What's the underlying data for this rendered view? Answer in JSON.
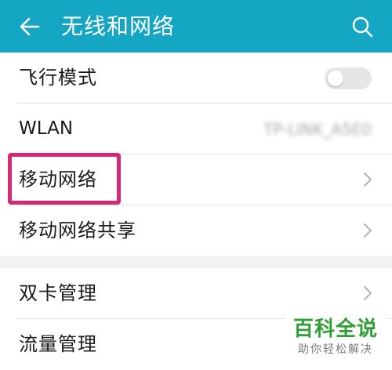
{
  "app_bar": {
    "title": "无线和网络",
    "back_icon": "arrow-left-icon",
    "search_icon": "search-icon",
    "background_color": "#14a6c2"
  },
  "settings": [
    {
      "group": 1,
      "items": [
        {
          "label": "飞行模式",
          "control": "toggle",
          "toggle_on": false
        },
        {
          "label": "WLAN",
          "control": "status",
          "status_text": "TP-LINK_A5E0"
        },
        {
          "label": "移动网络",
          "control": "chevron",
          "highlighted": true
        },
        {
          "label": "移动网络共享",
          "control": "chevron"
        }
      ]
    },
    {
      "group": 2,
      "items": [
        {
          "label": "双卡管理",
          "control": "chevron"
        },
        {
          "label": "流量管理",
          "control": "chevron"
        }
      ]
    }
  ],
  "highlight": {
    "target": "移动网络",
    "color": "#d62877"
  },
  "watermark": {
    "brand": "百科全说",
    "slogan": "助你轻松解决",
    "brand_color": "#2f9e34"
  }
}
